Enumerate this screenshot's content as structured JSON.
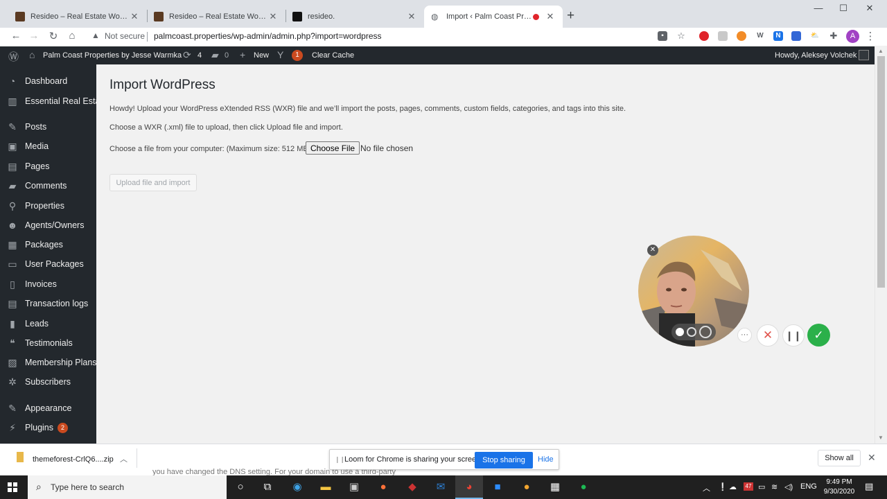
{
  "browser": {
    "tabs": [
      {
        "title": "Resideo – Real Estate WordPress",
        "active": false
      },
      {
        "title": "Resideo – Real Estate WordPress",
        "active": false
      },
      {
        "title": "resideo.",
        "active": false
      },
      {
        "title": "Import ‹ Palm Coast Properties",
        "active": true
      }
    ],
    "not_secure": "Not secure",
    "url": "palmcoast.properties/wp-admin/admin.php?import=wordpress",
    "profile_initial": "A"
  },
  "adminbar": {
    "site_name": "Palm Coast Properties by Jesse Warmka",
    "updates_count": "4",
    "comments_count": "0",
    "new_label": "New",
    "yoast_badge": "1",
    "clear_cache": "Clear Cache",
    "howdy": "Howdy, Aleksey Volchek"
  },
  "sidebar": {
    "items": [
      {
        "label": "Dashboard",
        "icon": "dashboard-icon"
      },
      {
        "label": "Essential Real Estate",
        "icon": "building-icon"
      },
      {
        "label": "Posts",
        "icon": "pin-icon"
      },
      {
        "label": "Media",
        "icon": "media-icon"
      },
      {
        "label": "Pages",
        "icon": "pages-icon"
      },
      {
        "label": "Comments",
        "icon": "comment-icon"
      },
      {
        "label": "Properties",
        "icon": "location-icon"
      },
      {
        "label": "Agents/Owners",
        "icon": "users-icon"
      },
      {
        "label": "Packages",
        "icon": "table-icon"
      },
      {
        "label": "User Packages",
        "icon": "card-icon"
      },
      {
        "label": "Invoices",
        "icon": "invoice-icon"
      },
      {
        "label": "Transaction logs",
        "icon": "log-icon"
      },
      {
        "label": "Leads",
        "icon": "book-icon"
      },
      {
        "label": "Testimonials",
        "icon": "quote-icon"
      },
      {
        "label": "Membership Plans",
        "icon": "id-icon"
      },
      {
        "label": "Subscribers",
        "icon": "gear-icon"
      },
      {
        "label": "Appearance",
        "icon": "brush-icon"
      },
      {
        "label": "Plugins",
        "icon": "plug-icon",
        "badge": "2"
      }
    ]
  },
  "main": {
    "title": "Import WordPress",
    "intro": "Howdy! Upload your WordPress eXtended RSS (WXR) file and we’ll import the posts, pages, comments, custom fields, categories, and tags into this site.",
    "instruction": "Choose a WXR (.xml) file to upload, then click Upload file and import.",
    "file_label": "Choose a file from your computer: (Maximum size: 512 MB)",
    "choose_button": "Choose File",
    "no_file": "No file chosen",
    "upload_button": "Upload file and import"
  },
  "loom": {
    "sharing_text": "Loom for Chrome is sharing your screen.",
    "stop_sharing": "Stop sharing",
    "hide": "Hide"
  },
  "downloads": {
    "file": "themeforest-CrlQ6....zip",
    "show_all": "Show all",
    "ghost_text": "you have changed the DNS setting. For your domain to use a third-party"
  },
  "taskbar": {
    "search_placeholder": "Type here to search",
    "language": "ENG",
    "time": "9:49 PM",
    "date": "9/30/2020",
    "weather_badge": "47"
  },
  "colors": {
    "wp_dark": "#23282d",
    "wp_badge": "#ca4a1f",
    "chrome_blue": "#1a73e8",
    "loom_green": "#2bb04a",
    "loom_red_x": "#e0524b"
  }
}
